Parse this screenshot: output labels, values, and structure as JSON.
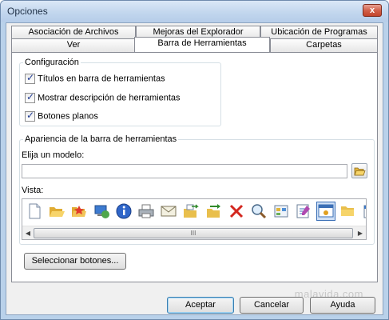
{
  "window": {
    "title": "Opciones",
    "close_glyph": "x"
  },
  "tabs": {
    "back_row": [
      "Asociación de Archivos",
      "Mejoras del Explorador",
      "Ubicación de Programas"
    ],
    "front_row": [
      "Ver",
      "Barra de Herramientas",
      "Carpetas"
    ],
    "selected": "Barra de Herramientas"
  },
  "configuracion": {
    "label": "Configuración",
    "options": [
      {
        "label": "Títulos en barra de herramientas",
        "checked": true
      },
      {
        "label": "Mostrar descripción de herramientas",
        "checked": true
      },
      {
        "label": "Botones planos",
        "checked": true
      }
    ],
    "check_glyph": "✓"
  },
  "apariencia": {
    "label": "Apariencia de la barra de herramientas",
    "model_label": "Elija un modelo:",
    "model_value": "",
    "preview_label": "Vista:",
    "preview_icons": [
      "new-file-icon",
      "open-folder-icon",
      "favorites-folder-icon",
      "network-icon",
      "info-icon",
      "print-icon",
      "email-icon",
      "copy-to-folder-icon",
      "move-to-folder-icon",
      "delete-icon",
      "search-icon",
      "view-icon",
      "properties-icon",
      "settings-icon",
      "folder-tree-icon",
      "calendar-icon",
      "map-drive-icon",
      "books-icon"
    ],
    "scroll_left": "◀",
    "scroll_right": "▶",
    "scroll_grip": "III"
  },
  "buttons": {
    "select": "Seleccionar botones...",
    "accept": "Aceptar",
    "cancel": "Cancelar",
    "help": "Ayuda"
  },
  "watermark": "malavida.com"
}
